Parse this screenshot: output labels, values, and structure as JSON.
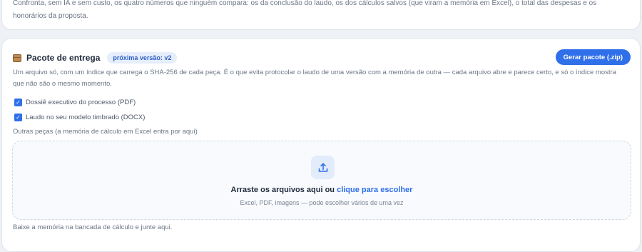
{
  "top_card": {
    "text": "Confronta, sem IA e sem custo, os quatro números que ninguém compara: os da conclusão do laudo, os dos cálculos salvos (que viram a memória em Excel), o total das despesas e os honorários da proposta."
  },
  "package": {
    "icon": "package-box-icon",
    "title": "Pacote de entrega",
    "badge": "próxima versão: v2",
    "generate_button": "Gerar pacote (.zip)",
    "description": "Um arquivo só, com um índice que carrega o SHA-256 de cada peça. É o que evita protocolar o laudo de uma versão com a memória de outra — cada arquivo abre e parece certo, e só o índice mostra que não são o mesmo momento.",
    "options": [
      {
        "label": "Dossiê executivo do processo (PDF)",
        "checked": true
      },
      {
        "label": "Laudo no seu modelo timbrado (DOCX)",
        "checked": true
      }
    ],
    "other_pieces_label": "Outras peças (a memória de cálculo em Excel entra por aqui)",
    "dropzone": {
      "icon": "upload-icon",
      "title_prefix": "Arraste os arquivos aqui ou",
      "title_link": "clique para escolher",
      "subtitle": "Excel, PDF, imagens — pode escolher vários de uma vez"
    },
    "footer_text": "Baixe a memória na bancada de cálculo e junte aqui."
  },
  "colors": {
    "accent": "#2f6fea",
    "badge_bg": "#e6eefc",
    "page_bg": "#eef1f6"
  }
}
